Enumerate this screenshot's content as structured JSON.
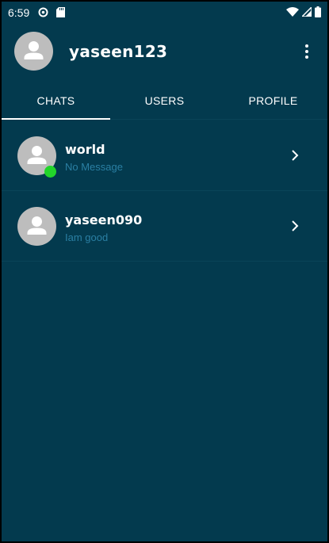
{
  "status_bar": {
    "time": "6:59",
    "icons": [
      "sync-icon",
      "sd-card-icon",
      "wifi-icon",
      "signal-icon",
      "battery-icon"
    ]
  },
  "header": {
    "username": "yaseen123",
    "avatar_icon": "person-icon",
    "menu_icon": "more-vert-icon"
  },
  "tabs": [
    {
      "label": "CHATS",
      "active": true
    },
    {
      "label": "USERS",
      "active": false
    },
    {
      "label": "PROFILE",
      "active": false
    }
  ],
  "chats": [
    {
      "name": "world",
      "message": "No Message",
      "online": true
    },
    {
      "name": "yaseen090",
      "message": "Iam good",
      "online": false
    }
  ],
  "colors": {
    "background": "#033a4e",
    "divider": "#0a4458",
    "avatar": "#bdbdbd",
    "online": "#22d62a",
    "message_text": "#2a7fa3",
    "text": "#ffffff"
  }
}
